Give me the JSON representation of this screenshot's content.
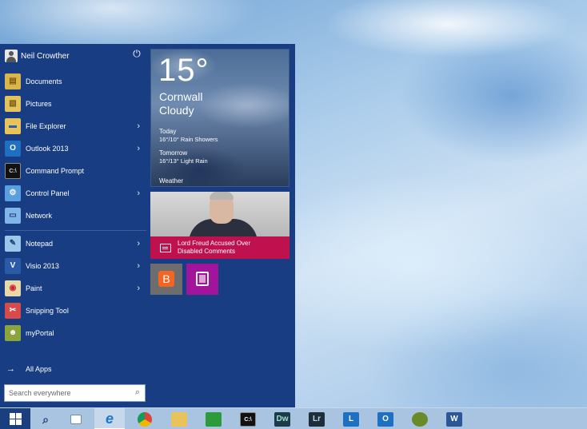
{
  "user": {
    "name": "Neil Crowther"
  },
  "menu_items": [
    {
      "label": "Documents",
      "icon": "documents-icon",
      "arrow": false
    },
    {
      "label": "Pictures",
      "icon": "pictures-icon",
      "arrow": false
    },
    {
      "label": "File Explorer",
      "icon": "file-explorer-icon",
      "arrow": true
    },
    {
      "label": "Outlook 2013",
      "icon": "outlook-icon",
      "arrow": true
    },
    {
      "label": "Command Prompt",
      "icon": "command-prompt-icon",
      "arrow": false
    },
    {
      "label": "Control Panel",
      "icon": "control-panel-icon",
      "arrow": true
    },
    {
      "label": "Network",
      "icon": "network-icon",
      "arrow": false
    },
    {
      "label": "Notepad",
      "icon": "notepad-icon",
      "arrow": true
    },
    {
      "label": "Visio 2013",
      "icon": "visio-icon",
      "arrow": true
    },
    {
      "label": "Paint",
      "icon": "paint-icon",
      "arrow": true
    },
    {
      "label": "Snipping Tool",
      "icon": "snipping-tool-icon",
      "arrow": false
    },
    {
      "label": "myPortal",
      "icon": "myportal-icon",
      "arrow": false
    }
  ],
  "all_apps": {
    "label": "All Apps"
  },
  "search": {
    "placeholder": "Search everywhere"
  },
  "weather": {
    "temperature": "15°",
    "city": "Cornwall",
    "condition": "Cloudy",
    "today_label": "Today",
    "today_detail": "16°/10° Rain Showers",
    "tomorrow_label": "Tomorrow",
    "tomorrow_detail": "16°/13° Light Rain",
    "tile_name": "Weather"
  },
  "news": {
    "headline": "Lord Freud Accused Over Disabled Comments"
  },
  "small_tiles": [
    {
      "glyph": "B",
      "icon": "blogger-icon"
    },
    {
      "glyph": "",
      "icon": "onenote-icon"
    }
  ],
  "taskbar": [
    {
      "icon": "windows-start-icon",
      "glyph": "",
      "active": false
    },
    {
      "icon": "search-icon",
      "glyph": "",
      "active": false
    },
    {
      "icon": "task-view-icon",
      "glyph": "",
      "active": false
    },
    {
      "icon": "internet-explorer-icon",
      "glyph": "e",
      "active": true
    },
    {
      "icon": "chrome-icon",
      "glyph": "",
      "active": false
    },
    {
      "icon": "file-explorer-icon",
      "glyph": "",
      "active": false
    },
    {
      "icon": "store-icon",
      "glyph": "",
      "active": false
    },
    {
      "icon": "command-prompt-icon",
      "glyph": "C:\\",
      "active": false
    },
    {
      "icon": "dreamweaver-icon",
      "glyph": "Dw",
      "active": false
    },
    {
      "icon": "lightroom-icon",
      "glyph": "Lr",
      "active": false
    },
    {
      "icon": "lync-icon",
      "glyph": "L",
      "active": false
    },
    {
      "icon": "outlook-icon",
      "glyph": "O",
      "active": false
    },
    {
      "icon": "myportal-icon",
      "glyph": "",
      "active": false
    },
    {
      "icon": "word-icon",
      "glyph": "W",
      "active": false
    }
  ]
}
